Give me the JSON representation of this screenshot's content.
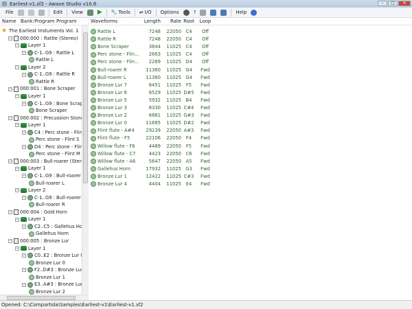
{
  "window": {
    "title": "Earliest-v1.sf2 - Awave Studio v10.6"
  },
  "toolbar": {
    "file": "File",
    "edit": "Edit",
    "view": "View",
    "tools": "Tools",
    "io": "I/O",
    "options": "Options",
    "help": "Help"
  },
  "tree_header": {
    "name": "Name",
    "bank_program": "Bank:Program",
    "program": "Program"
  },
  "list_header": {
    "waveforms": "Waveforms",
    "length": "Length",
    "rate": "Rate",
    "root": "Root",
    "loop": "Loop"
  },
  "tree": [
    {
      "label": "The Earliest Instuments Vol. 1",
      "depth": 0,
      "type": "root"
    },
    {
      "label": "000:000 : Rattle (Stereo)",
      "depth": 1,
      "type": "prog"
    },
    {
      "label": "Layer 1",
      "depth": 2,
      "type": "layer"
    },
    {
      "label": "C-1..G9 : Rattle L",
      "depth": 3,
      "type": "split"
    },
    {
      "label": "Rattle L",
      "depth": 4,
      "type": "sample"
    },
    {
      "label": "Layer 2",
      "depth": 2,
      "type": "layer"
    },
    {
      "label": "C-1..G9 : Rattle R",
      "depth": 3,
      "type": "split"
    },
    {
      "label": "Rattle R",
      "depth": 4,
      "type": "sample"
    },
    {
      "label": "000:001 : Bone Scraper",
      "depth": 1,
      "type": "prog"
    },
    {
      "label": "Layer 1",
      "depth": 2,
      "type": "layer"
    },
    {
      "label": "C-1..G9 : Bone Scraper",
      "depth": 3,
      "type": "split"
    },
    {
      "label": "Bone Scraper",
      "depth": 4,
      "type": "sample"
    },
    {
      "label": "000:002 : Precussion Stones",
      "depth": 1,
      "type": "prog"
    },
    {
      "label": "Layer 1",
      "depth": 2,
      "type": "layer"
    },
    {
      "label": "C4 : Perc stone - Flint S",
      "depth": 3,
      "type": "split"
    },
    {
      "label": "Perc stone - Flint S",
      "depth": 4,
      "type": "sample"
    },
    {
      "label": "D4 : Perc stone - Flint M",
      "depth": 3,
      "type": "split"
    },
    {
      "label": "Perc stone - Flint M",
      "depth": 4,
      "type": "sample"
    },
    {
      "label": "000:003 : Bull-roarer (Stereo)",
      "depth": 1,
      "type": "prog"
    },
    {
      "label": "Layer 1",
      "depth": 2,
      "type": "layer"
    },
    {
      "label": "C-1..G9 : Bull-roarer L",
      "depth": 3,
      "type": "split"
    },
    {
      "label": "Bull-roarer L",
      "depth": 4,
      "type": "sample"
    },
    {
      "label": "Layer 2",
      "depth": 2,
      "type": "layer"
    },
    {
      "label": "C-1..G9 : Bull-roarer R",
      "depth": 3,
      "type": "split"
    },
    {
      "label": "Bull-roarer R",
      "depth": 4,
      "type": "sample"
    },
    {
      "label": "000:004 : Gold Horn",
      "depth": 1,
      "type": "prog"
    },
    {
      "label": "Layer 1",
      "depth": 2,
      "type": "layer"
    },
    {
      "label": "C2..C5 : Gallehus Horn",
      "depth": 3,
      "type": "split"
    },
    {
      "label": "Gallehus Horn",
      "depth": 4,
      "type": "sample"
    },
    {
      "label": "000:005 : Bronze Lur",
      "depth": 1,
      "type": "prog"
    },
    {
      "label": "Layer 1",
      "depth": 2,
      "type": "layer"
    },
    {
      "label": "C0..E2 : Bronze Lur 0",
      "depth": 3,
      "type": "split"
    },
    {
      "label": "Bronze Lur 0",
      "depth": 4,
      "type": "sample"
    },
    {
      "label": "F2..D#3 : Bronze Lur 1",
      "depth": 3,
      "type": "split"
    },
    {
      "label": "Bronze Lur 1",
      "depth": 4,
      "type": "sample"
    },
    {
      "label": "E3..A#3 : Bronze Lur 2",
      "depth": 3,
      "type": "split"
    },
    {
      "label": "Bronze Lur 2",
      "depth": 4,
      "type": "sample"
    }
  ],
  "waveforms": [
    {
      "name": "Rattle L",
      "length": "7248",
      "rate": "22050",
      "root": "C4",
      "loop": "Off"
    },
    {
      "name": "Rattle R",
      "length": "7248",
      "rate": "22050",
      "root": "C4",
      "loop": "Off"
    },
    {
      "name": "Bone Scraper",
      "length": "3844",
      "rate": "11025",
      "root": "C4",
      "loop": "Off"
    },
    {
      "name": "Perc stone - Flin...",
      "length": "2663",
      "rate": "11025",
      "root": "C4",
      "loop": "Off"
    },
    {
      "name": "Perc stone - Flin...",
      "length": "2289",
      "rate": "11025",
      "root": "D4",
      "loop": "Off"
    },
    {
      "name": "Bull-roarer R",
      "length": "11360",
      "rate": "11025",
      "root": "G4",
      "loop": "Fwd"
    },
    {
      "name": "Bull-roarer L",
      "length": "11360",
      "rate": "11025",
      "root": "G4",
      "loop": "Fwd"
    },
    {
      "name": "Bronze Lur 7",
      "length": "6451",
      "rate": "11025",
      "root": "F5",
      "loop": "Fwd"
    },
    {
      "name": "Bronze Lur 6",
      "length": "6529",
      "rate": "11025",
      "root": "D#5",
      "loop": "Fwd"
    },
    {
      "name": "Bronze Lur 5",
      "length": "5932",
      "rate": "11025",
      "root": "B4",
      "loop": "Fwd"
    },
    {
      "name": "Bronze Lur 3",
      "length": "8330",
      "rate": "11025",
      "root": "C#4",
      "loop": "Fwd"
    },
    {
      "name": "Bronze Lur 2",
      "length": "6881",
      "rate": "11025",
      "root": "G#3",
      "loop": "Fwd"
    },
    {
      "name": "Bronze Lur 0",
      "length": "11685",
      "rate": "11025",
      "root": "D#2",
      "loop": "Fwd"
    },
    {
      "name": "Flint flute - A#4",
      "length": "29239",
      "rate": "22050",
      "root": "A#3",
      "loop": "Fwd"
    },
    {
      "name": "Flint flute - F5",
      "length": "22106",
      "rate": "22050",
      "root": "F4",
      "loop": "Fwd"
    },
    {
      "name": "Willow flute - F6",
      "length": "4489",
      "rate": "22050",
      "root": "F5",
      "loop": "Fwd"
    },
    {
      "name": "Willow flute - C7",
      "length": "4423",
      "rate": "22050",
      "root": "C6",
      "loop": "Fwd"
    },
    {
      "name": "Willow flute - A6",
      "length": "5647",
      "rate": "22050",
      "root": "A5",
      "loop": "Fwd"
    },
    {
      "name": "Gallehus Horn",
      "length": "17932",
      "rate": "11025",
      "root": "G3",
      "loop": "Fwd"
    },
    {
      "name": "Bronze Lur 1",
      "length": "12422",
      "rate": "11025",
      "root": "C#3",
      "loop": "Fwd"
    },
    {
      "name": "Bronze Lur 4",
      "length": "4404",
      "rate": "11025",
      "root": "E4",
      "loop": "Fwd"
    }
  ],
  "status": {
    "text": "Opened: C:\\Compartida\\Samples\\Earliest-v1\\Earliest-v1.sf2"
  }
}
